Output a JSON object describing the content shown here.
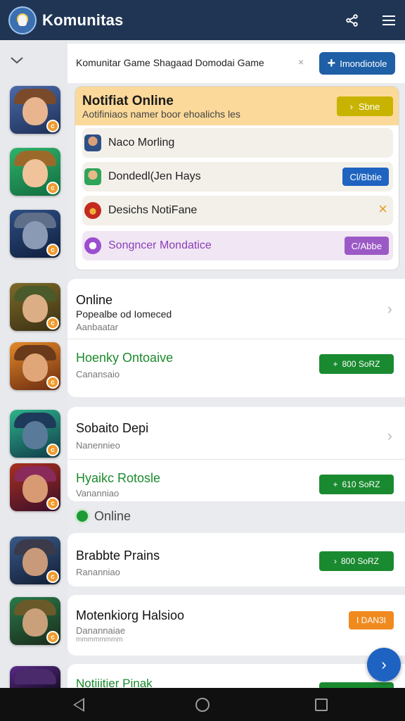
{
  "header": {
    "title": "Komunitas",
    "icons": [
      "logo-icon",
      "share-icon",
      "menu-icon"
    ]
  },
  "search": {
    "text": "Komunitar Game Shagaad Domodai Game",
    "clear_glyph": "×",
    "button_label": "Imondiotole"
  },
  "notification_panel": {
    "title": "Notifiat Online",
    "subtitle": "Aotifiniaos namer boor ehoalichs les",
    "action_label": "Sbne",
    "rows": [
      {
        "label": "Naco Morling",
        "icon": "user-avatar-icon",
        "action": ""
      },
      {
        "label": "Dondedl(Jen Hays",
        "icon": "game-avatar-icon",
        "action": "Cl/Bbtie"
      },
      {
        "label": "Desichs NotiFane",
        "icon": "flame-icon",
        "action": "×"
      },
      {
        "label": "Songncer Mondatice",
        "icon": "smile-icon",
        "action": "C/Abbe"
      }
    ]
  },
  "list_sections": [
    {
      "items": [
        {
          "title": "Online",
          "sub1": "Popealbe od Iomeced",
          "sub2": "Aanbaatar",
          "action": "chevron"
        },
        {
          "title": "Hoenky Ontoaive",
          "sub1": "Canansaio",
          "action": "button",
          "button_label": "800 SoRZ"
        }
      ]
    },
    {
      "items": [
        {
          "title": "Sobaito Depi",
          "sub1": "Nanennieo",
          "action": "chevron"
        },
        {
          "title": "Hyaikc Rotosle",
          "sub1": "Vananniao",
          "action": "button",
          "button_label": "610 SoRZ"
        }
      ]
    }
  ],
  "online_indicator": {
    "label": "Online"
  },
  "bottom_items": [
    {
      "title": "Brabbte Prains",
      "sub1": "Rananniao",
      "button_label": "800 SoRZ"
    },
    {
      "title": "Motenkiorg Halsioo",
      "sub1": "Danannaiae",
      "sub2": "mmmmmmmm",
      "button_label": "I DAN3I"
    },
    {
      "title": "Notiiitier Pinak"
    }
  ],
  "fab": {
    "icon": "chevron-right-icon"
  },
  "colors": {
    "topbar": "#1f3553",
    "primary_button": "#1e5fa6",
    "notification_header": "#fbd99a",
    "success_green": "#1a8a30",
    "warning_orange": "#f08a1f",
    "purple_accent": "#9b59c6"
  }
}
